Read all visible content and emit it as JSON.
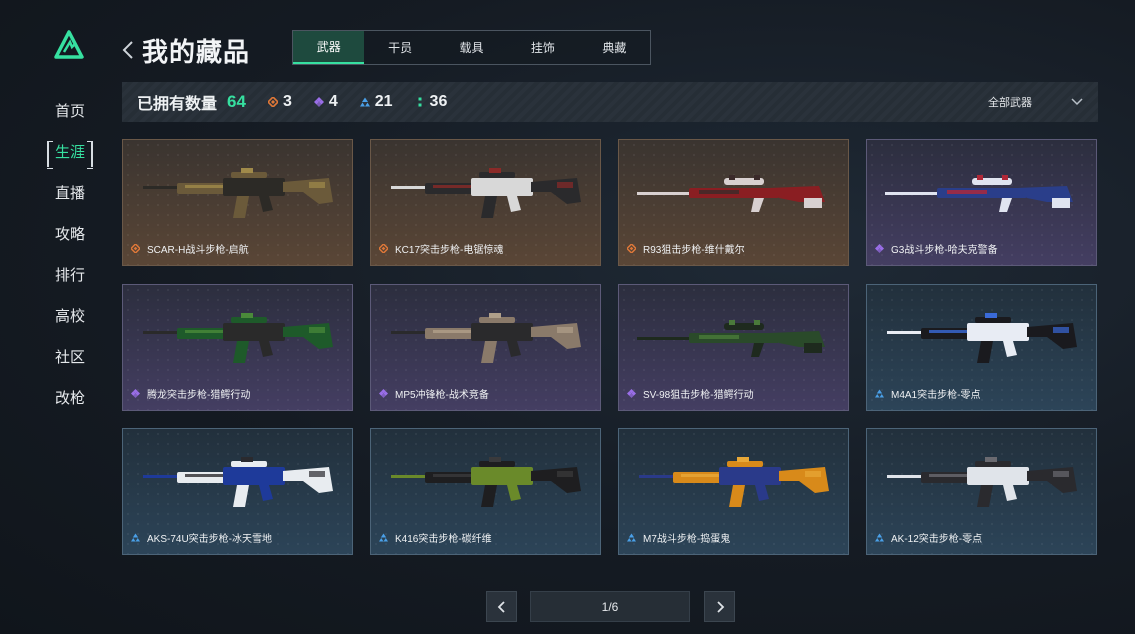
{
  "colors": {
    "accent": "#36e0a0",
    "orange": "#e07838",
    "purple": "#9a6ee8",
    "blue": "#4aa0e8"
  },
  "sidebar": {
    "logo_icon": "triangle-logo-icon",
    "items": [
      {
        "label": "首页",
        "active": false
      },
      {
        "label": "生涯",
        "active": true
      },
      {
        "label": "直播",
        "active": false
      },
      {
        "label": "攻略",
        "active": false
      },
      {
        "label": "排行",
        "active": false
      },
      {
        "label": "高校",
        "active": false
      },
      {
        "label": "社区",
        "active": false
      },
      {
        "label": "改枪",
        "active": false
      }
    ]
  },
  "header": {
    "back_icon": "chevron-left-icon",
    "title": "我的藏品",
    "tabs": [
      {
        "label": "武器",
        "active": true
      },
      {
        "label": "干员",
        "active": false
      },
      {
        "label": "载具",
        "active": false
      },
      {
        "label": "挂饰",
        "active": false
      },
      {
        "label": "典藏",
        "active": false
      }
    ]
  },
  "stats": {
    "own_label": "已拥有数量",
    "own_count": "64",
    "rarities": [
      {
        "tier": "orange",
        "count": "3"
      },
      {
        "tier": "purple",
        "count": "4"
      },
      {
        "tier": "blue",
        "count": "21"
      },
      {
        "tier": "green",
        "count": "36"
      }
    ],
    "filter_label": "全部武器",
    "filter_icon": "chevron-down-icon"
  },
  "items": [
    {
      "name": "SCAR-H战斗步枪-启航",
      "tier": "orange",
      "palette": [
        "#6b5a3a",
        "#2c2a26",
        "#a08a4a"
      ]
    },
    {
      "name": "KC17突击步枪-电锯惊魂",
      "tier": "orange",
      "palette": [
        "#2a2a2c",
        "#d8d8d8",
        "#8a2a28"
      ]
    },
    {
      "name": "R93狙击步枪-维什戴尔",
      "tier": "orange",
      "palette": [
        "#8a1e22",
        "#d8d0d0",
        "#3a2a2a"
      ]
    },
    {
      "name": "G3战斗步枪-哈夫克警备",
      "tier": "purple",
      "palette": [
        "#2a3e8a",
        "#e0e4f0",
        "#b02838"
      ]
    },
    {
      "name": "腾龙突击步枪-猎鳄行动",
      "tier": "purple",
      "palette": [
        "#1e5a2a",
        "#2a2a2a",
        "#4a8a3a"
      ]
    },
    {
      "name": "MP5冲锋枪-战术竞备",
      "tier": "purple",
      "palette": [
        "#8a7a6a",
        "#2a2a2c",
        "#b0a08a"
      ]
    },
    {
      "name": "SV-98狙击步枪-猎鳄行动",
      "tier": "purple",
      "palette": [
        "#2a4a2a",
        "#1e2a1e",
        "#4a7a3a"
      ]
    },
    {
      "name": "M4A1突击步枪-零点",
      "tier": "blue",
      "palette": [
        "#1a1a1e",
        "#e8ecf4",
        "#3a6ad8"
      ]
    },
    {
      "name": "AKS-74U突击步枪-冰天雪地",
      "tier": "blue",
      "palette": [
        "#e8ecf0",
        "#1e3a9a",
        "#2a2a2e"
      ]
    },
    {
      "name": "K416突击步枪-碳纤维",
      "tier": "blue",
      "palette": [
        "#1e1e20",
        "#6a8a2a",
        "#3a3a3c"
      ]
    },
    {
      "name": "M7战斗步枪-捣蛋鬼",
      "tier": "blue",
      "palette": [
        "#d88a1a",
        "#2a3a8a",
        "#e8a838"
      ]
    },
    {
      "name": "AK-12突击步枪-零点",
      "tier": "blue",
      "palette": [
        "#2a2a2e",
        "#e0e4ea",
        "#6a6a70"
      ]
    }
  ],
  "pager": {
    "text": "1/6",
    "prev_icon": "chevron-left-icon",
    "next_icon": "chevron-right-icon"
  }
}
